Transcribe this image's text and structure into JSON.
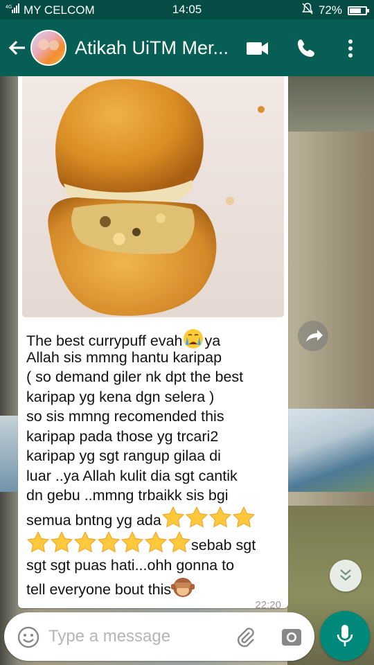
{
  "status_bar": {
    "carrier": "MY CELCOM",
    "time": "14:05",
    "battery": "72%",
    "battery_level": 0.72,
    "icons": [
      "signal-icon",
      "mute-icon",
      "battery-icon"
    ]
  },
  "header": {
    "contact_name": "Atikah UiTM Mer...",
    "icons": [
      "back-arrow-icon",
      "video-call-icon",
      "phone-icon",
      "more-vert-icon"
    ]
  },
  "message": {
    "image_icon": "curry-puff-photo",
    "text_lines": [
      "The best currypuff evah",
      "ya",
      "Allah sis mmng hantu karipap",
      "( so demand giler nk dpt the best",
      "karipap yg kena dgn selera )",
      "so sis mmng recomended this",
      "karipap pada those yg trcari2",
      "karipap yg sgt rangup gilaa di",
      "luar ..ya Allah kulit dia sgt cantik",
      "dn gebu ..mmng trbaikk sis bgi",
      "semua bntng yg ada",
      "sebab sgt",
      "sgt sgt puas hati...ohh gonna to",
      "tell everyone bout this"
    ],
    "emoji": [
      "crying-face-emoji",
      "star-emoji",
      "see-no-evil-monkey-emoji"
    ],
    "stars_row1": 4,
    "stars_row2": 7,
    "timestamp": "22:20"
  },
  "composer": {
    "placeholder": "Type a message",
    "icons": [
      "emoji-icon",
      "attach-icon",
      "camera-icon",
      "mic-icon"
    ]
  },
  "colors": {
    "header": "#075e54",
    "status_bar": "#054d44",
    "accent": "#00897b"
  }
}
